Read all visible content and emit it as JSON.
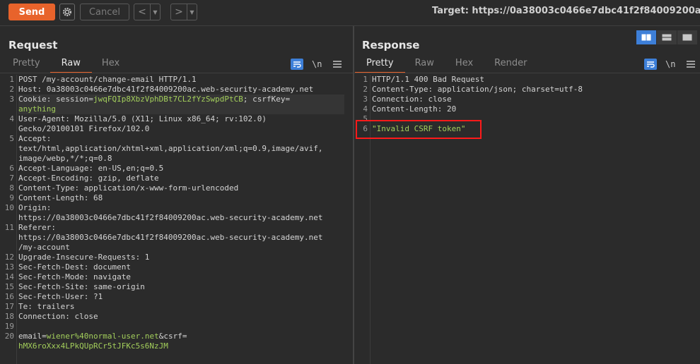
{
  "toolbar": {
    "send_label": "Send",
    "cancel_label": "Cancel",
    "back_glyph": "<",
    "forward_glyph": ">",
    "dropdown_glyph": "▼",
    "target_text": "Target: https://0a38003c0466e7dbc41f2f84009200ac.web"
  },
  "request": {
    "title": "Request",
    "tabs": [
      "Pretty",
      "Raw",
      "Hex"
    ],
    "active_tab": "Raw",
    "newline_label": "\\n",
    "line_numbers": [
      "1",
      "2",
      "3",
      "",
      "4",
      "",
      "5",
      "",
      "",
      "6",
      "7",
      "8",
      "9",
      "10",
      "",
      "11",
      "",
      "",
      "12",
      "13",
      "14",
      "15",
      "16",
      "17",
      "18",
      "19",
      "20",
      ""
    ],
    "lines": [
      {
        "k": "POST /my-account/change-email HTTP/1.1"
      },
      {
        "k": "Host:",
        "v": " 0a38003c0466e7dbc41f2f84009200ac.web-security-academy.net"
      },
      {
        "k": "Cookie:",
        "v": " session=",
        "g": "jwqFQIp8XbzVphDBt7CL2fYzSwpdPtCB",
        "v2": "; csrfKey="
      },
      {
        "g": "anything"
      },
      {
        "k": "User-Agent:",
        "v": " Mozilla/5.0 (X11; Linux x86_64; rv:102.0)"
      },
      {
        "v": "Gecko/20100101 Firefox/102.0"
      },
      {
        "k": "Accept:"
      },
      {
        "v": "text/html,application/xhtml+xml,application/xml;q=0.9,image/avif,"
      },
      {
        "v": "image/webp,*/*;q=0.8"
      },
      {
        "k": "Accept-Language:",
        "v": " en-US,en;q=0.5"
      },
      {
        "k": "Accept-Encoding:",
        "v": " gzip, deflate"
      },
      {
        "k": "Content-Type:",
        "v": " application/x-www-form-urlencoded"
      },
      {
        "k": "Content-Length:",
        "v": " 68"
      },
      {
        "k": "Origin:"
      },
      {
        "v": "https://0a38003c0466e7dbc41f2f84009200ac.web-security-academy.net"
      },
      {
        "k": "Referer:"
      },
      {
        "v": "https://0a38003c0466e7dbc41f2f84009200ac.web-security-academy.net"
      },
      {
        "v": "/my-account"
      },
      {
        "k": "Upgrade-Insecure-Requests:",
        "v": " 1"
      },
      {
        "k": "Sec-Fetch-Dest:",
        "v": " document"
      },
      {
        "k": "Sec-Fetch-Mode:",
        "v": " navigate"
      },
      {
        "k": "Sec-Fetch-Site:",
        "v": " same-origin"
      },
      {
        "k": "Sec-Fetch-User:",
        "v": " ?1"
      },
      {
        "k": "Te:",
        "v": " trailers"
      },
      {
        "k": "Connection:",
        "v": " close"
      },
      {
        "v": ""
      },
      {
        "k": "email=",
        "g": "wiener%40normal-user.net",
        "v2": "&csrf="
      },
      {
        "g": "hMX6roXxx4LPkQUpRCr5tJFKc5s6NzJM"
      }
    ]
  },
  "response": {
    "title": "Response",
    "tabs": [
      "Pretty",
      "Raw",
      "Hex",
      "Render"
    ],
    "active_tab": "Pretty",
    "newline_label": "\\n",
    "line_numbers": [
      "1",
      "2",
      "3",
      "4",
      "5",
      "6"
    ],
    "lines": [
      {
        "k": "HTTP/1.1 400 Bad Request"
      },
      {
        "k": "Content-Type:",
        "v": " application/json; charset=utf-8"
      },
      {
        "k": "Connection:",
        "v": " close"
      },
      {
        "k": "Content-Length:",
        "v": " 20"
      },
      {
        "v": ""
      },
      {
        "g": "\"Invalid CSRF token\""
      }
    ]
  },
  "colors": {
    "accent": "#e8632b",
    "selected_blue": "#3d7fd8",
    "value_green": "#a3cf5b",
    "highlight_red": "#ff1a1a"
  }
}
